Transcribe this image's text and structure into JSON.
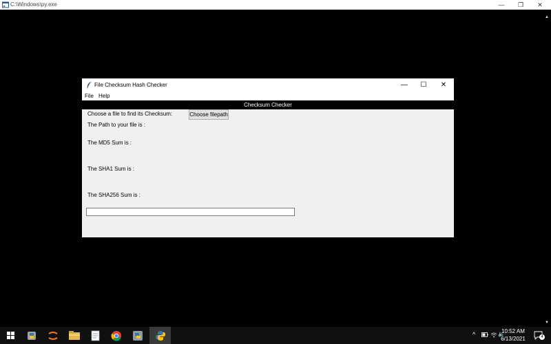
{
  "console": {
    "title": "C:\\Windows\\py.exe",
    "minimize_glyph": "—",
    "restore_glyph": "❐",
    "close_glyph": "✕"
  },
  "app": {
    "title": "File Checksum Hash Checker",
    "minimize_glyph": "—",
    "maximize_glyph": "☐",
    "close_glyph": "✕",
    "menu": [
      "File",
      "Help"
    ],
    "header": "Checksum Checker",
    "choose_label": "Choose a file to find its Checksum:",
    "choose_button": "Choose filepath",
    "path_label": "The Path to your file is :",
    "md5_label": "The MD5 Sum is :",
    "sha1_label": "The SHA1 Sum is :",
    "sha256_label": "The SHA256 Sum is :",
    "entry_value": ""
  },
  "taskbar": {
    "icons": [
      "windows-start-icon",
      "python-idle-icon",
      "jupyter-icon",
      "file-explorer-icon",
      "notepad-icon",
      "chrome-icon",
      "python-launcher-icon",
      "python-running-icon"
    ],
    "time": "10:52 AM",
    "date": "6/13/2021",
    "notification_count": "4",
    "chevron_glyph": "^"
  }
}
